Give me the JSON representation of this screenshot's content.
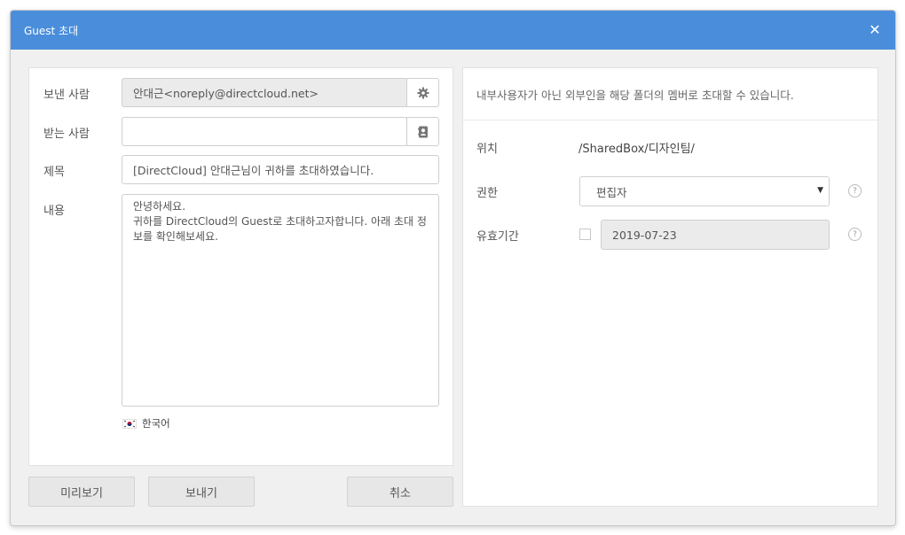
{
  "dialog": {
    "title": "Guest 초대",
    "close_glyph": "✕"
  },
  "form": {
    "sender_label": "보낸 사람",
    "sender_value": "안대근<noreply@directcloud.net>",
    "sender_settings_icon": "gear-icon",
    "recipient_label": "받는 사람",
    "recipient_value": "",
    "recipient_addressbook_icon": "address-book-icon",
    "subject_label": "제목",
    "subject_value": "[DirectCloud] 안대근님이 귀하를 초대하였습니다.",
    "content_label": "내용",
    "content_value": "안녕하세요.\n귀하를 DirectCloud의 Guest로 초대하고자합니다. 아래 초대 정보를 확인해보세요.",
    "language_flag_icon": "korea-flag-icon",
    "language_label": "한국어"
  },
  "buttons": {
    "preview": "미리보기",
    "send": "보내기",
    "cancel": "취소"
  },
  "info": {
    "description": "내부사용자가 아닌 외부인을 해당 폴더의 멤버로 초대할 수 있습니다.",
    "location_label": "위치",
    "location_value": "/SharedBox/디자인팀/",
    "permission_label": "권한",
    "permission_value": "편집자",
    "permission_options": [
      "편집자"
    ],
    "expiry_label": "유효기간",
    "expiry_value": "2019-07-23",
    "expiry_enabled": false,
    "help_glyph": "?"
  },
  "colors": {
    "titlebar": "#4a8edb",
    "button_bg": "#e7e7e7",
    "disabled_field": "#ebebeb"
  }
}
